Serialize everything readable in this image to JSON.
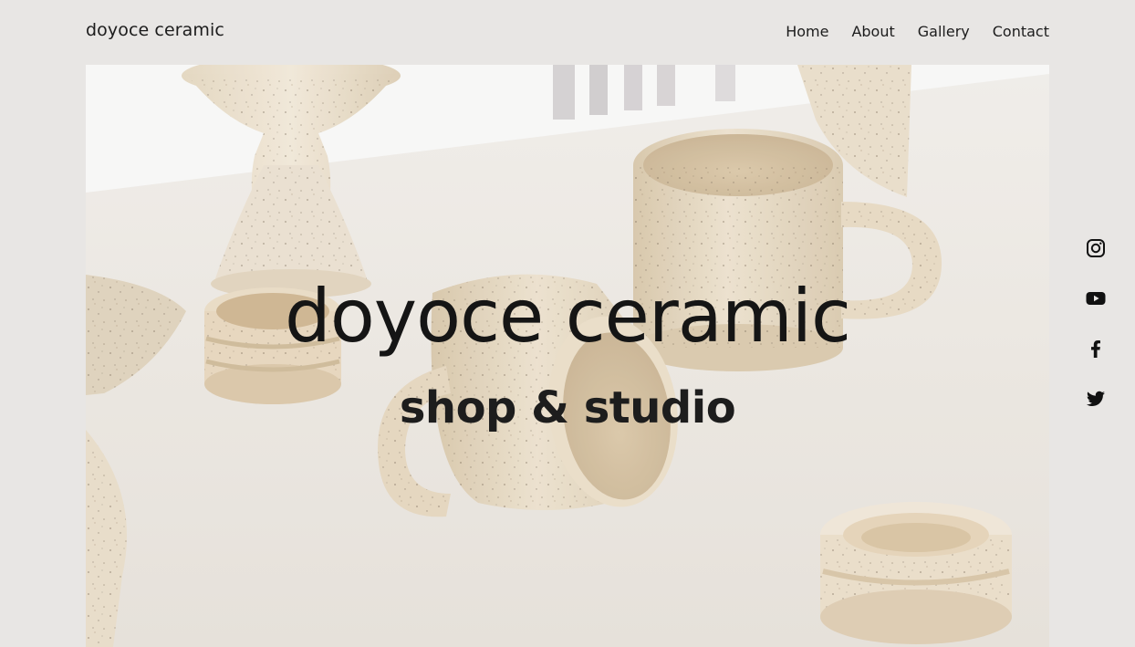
{
  "header": {
    "site_title": "doyoce ceramic",
    "nav": [
      {
        "label": "Home"
      },
      {
        "label": "About"
      },
      {
        "label": "Gallery"
      },
      {
        "label": "Contact"
      }
    ]
  },
  "hero": {
    "title": "doyoce ceramic",
    "subtitle": "shop & studio",
    "image_subject": "speckled ceramic cups, pedestal bowls and lidded pots on a white table"
  },
  "social": [
    {
      "icon": "instagram-icon"
    },
    {
      "icon": "youtube-icon"
    },
    {
      "icon": "facebook-icon"
    },
    {
      "icon": "twitter-icon"
    }
  ],
  "colors": {
    "background": "#e8e6e4",
    "text": "#1c1c1c",
    "ceramic": "#e3d6c1",
    "table": "#ece8e2"
  }
}
